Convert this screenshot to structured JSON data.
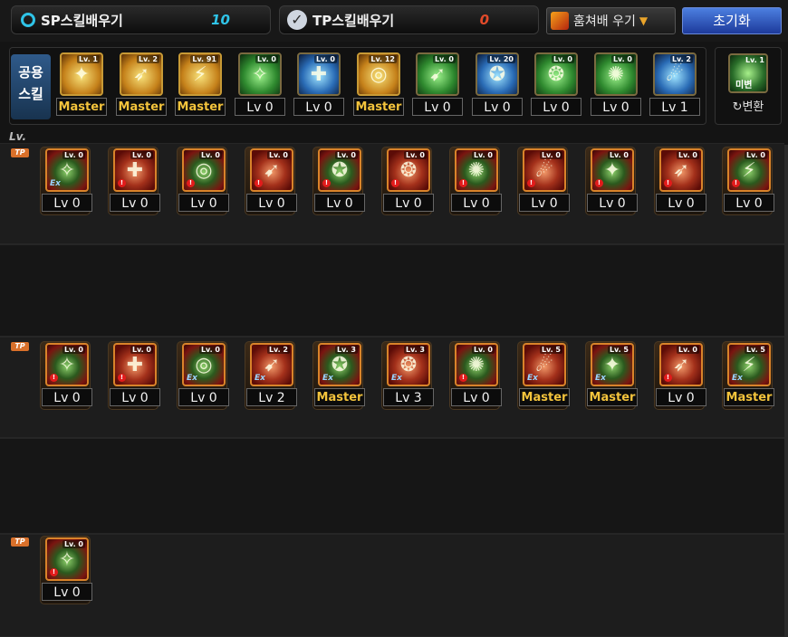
{
  "topbar": {
    "sp_label": "SP스킬배우기",
    "sp_value": "10",
    "tp_label": "TP스킬배우기",
    "tp_value": "0",
    "dropdown_value": "훔쳐배 우기",
    "reset_label": "초기화",
    "colors": {
      "sp_value": "#2fc4e8",
      "tp_value": "#e24a2a",
      "master": "#f3c33c"
    }
  },
  "common": {
    "label_line1": "공용",
    "label_line2": "스킬",
    "skills": [
      {
        "icon": "running-icon",
        "tag": "Lv. 1",
        "level": "Master"
      },
      {
        "icon": "leap-icon",
        "tag": "Lv. 2",
        "level": "Master"
      },
      {
        "icon": "strike-icon",
        "tag": "Lv. 91",
        "level": "Master"
      },
      {
        "icon": "wings-icon",
        "tag": "Lv. 0",
        "level": "Lv 0"
      },
      {
        "icon": "crosshair-icon",
        "tag": "Lv. 0",
        "level": "Lv 0"
      },
      {
        "icon": "target-icon",
        "tag": "Lv. 12",
        "level": "Master"
      },
      {
        "icon": "dash-icon",
        "tag": "Lv. 0",
        "level": "Lv 0"
      },
      {
        "icon": "jump-icon",
        "tag": "Lv. 20",
        "level": "Lv 0"
      },
      {
        "icon": "vortex-icon",
        "tag": "Lv. 0",
        "level": "Lv 0"
      },
      {
        "icon": "armor-icon",
        "tag": "Lv. 0",
        "level": "Lv 0"
      },
      {
        "icon": "swift-icon",
        "tag": "Lv. 2",
        "level": "Lv 1"
      }
    ],
    "transform_tag": "Lv. 1",
    "transform_icon_text": "미변",
    "transform_label": "↻변환"
  },
  "lv_marker": "Lv.",
  "tp_marker": "TP",
  "row1": [
    {
      "icon": "spin-kick-icon",
      "tag": "Lv. 0",
      "level": "Lv 0",
      "mark": "ex"
    },
    {
      "icon": "slash-icon",
      "tag": "Lv. 0",
      "level": "Lv 0",
      "mark": "alert"
    },
    {
      "icon": "claw-icon",
      "tag": "Lv. 0",
      "level": "Lv 0",
      "mark": "alert"
    },
    {
      "icon": "thrust-icon",
      "tag": "Lv. 0",
      "level": "Lv 0",
      "mark": "alert"
    },
    {
      "icon": "shield-icon",
      "tag": "Lv. 0",
      "level": "Lv 0",
      "mark": "alert"
    },
    {
      "icon": "whirl-icon",
      "tag": "Lv. 0",
      "level": "Lv 0",
      "mark": "alert"
    },
    {
      "icon": "flame-icon",
      "tag": "Lv. 0",
      "level": "Lv 0",
      "mark": "alert"
    },
    {
      "icon": "burst-icon",
      "tag": "Lv. 0",
      "level": "Lv 0",
      "mark": "alert"
    },
    {
      "icon": "arc-icon",
      "tag": "Lv. 0",
      "level": "Lv 0",
      "mark": "alert"
    },
    {
      "icon": "cross-icon",
      "tag": "Lv. 0",
      "level": "Lv 0",
      "mark": "alert"
    },
    {
      "icon": "cyclone-icon",
      "tag": "Lv. 0",
      "level": "Lv 0",
      "mark": "alert"
    }
  ],
  "row2": [
    {
      "icon": "crescent-icon",
      "tag": "Lv. 0",
      "level": "Lv 0",
      "mark": "alert"
    },
    {
      "icon": "impact-icon",
      "tag": "Lv. 0",
      "level": "Lv 0",
      "mark": "alert"
    },
    {
      "icon": "orb-icon",
      "tag": "Lv. 0",
      "level": "Lv 0",
      "mark": "ex"
    },
    {
      "icon": "wave-icon",
      "tag": "Lv. 2",
      "level": "Lv 2",
      "mark": "ex"
    },
    {
      "icon": "mask-icon",
      "tag": "Lv. 3",
      "level": "Master",
      "mark": "ex"
    },
    {
      "icon": "demon-icon",
      "tag": "Lv. 3",
      "level": "Lv 3",
      "mark": "ex"
    },
    {
      "icon": "rays-icon",
      "tag": "Lv. 0",
      "level": "Lv 0",
      "mark": "alert"
    },
    {
      "icon": "star-burst-icon",
      "tag": "Lv. 5",
      "level": "Master",
      "mark": "ex"
    },
    {
      "icon": "rise-icon",
      "tag": "Lv. 5",
      "level": "Master",
      "mark": "ex"
    },
    {
      "icon": "storm-icon",
      "tag": "Lv. 0",
      "level": "Lv 0",
      "mark": "alert"
    },
    {
      "icon": "tower-icon",
      "tag": "Lv. 5",
      "level": "Master",
      "mark": "ex"
    }
  ],
  "row3": [
    {
      "icon": "phantom-icon",
      "tag": "Lv. 0",
      "level": "Lv 0",
      "mark": "alert"
    }
  ]
}
